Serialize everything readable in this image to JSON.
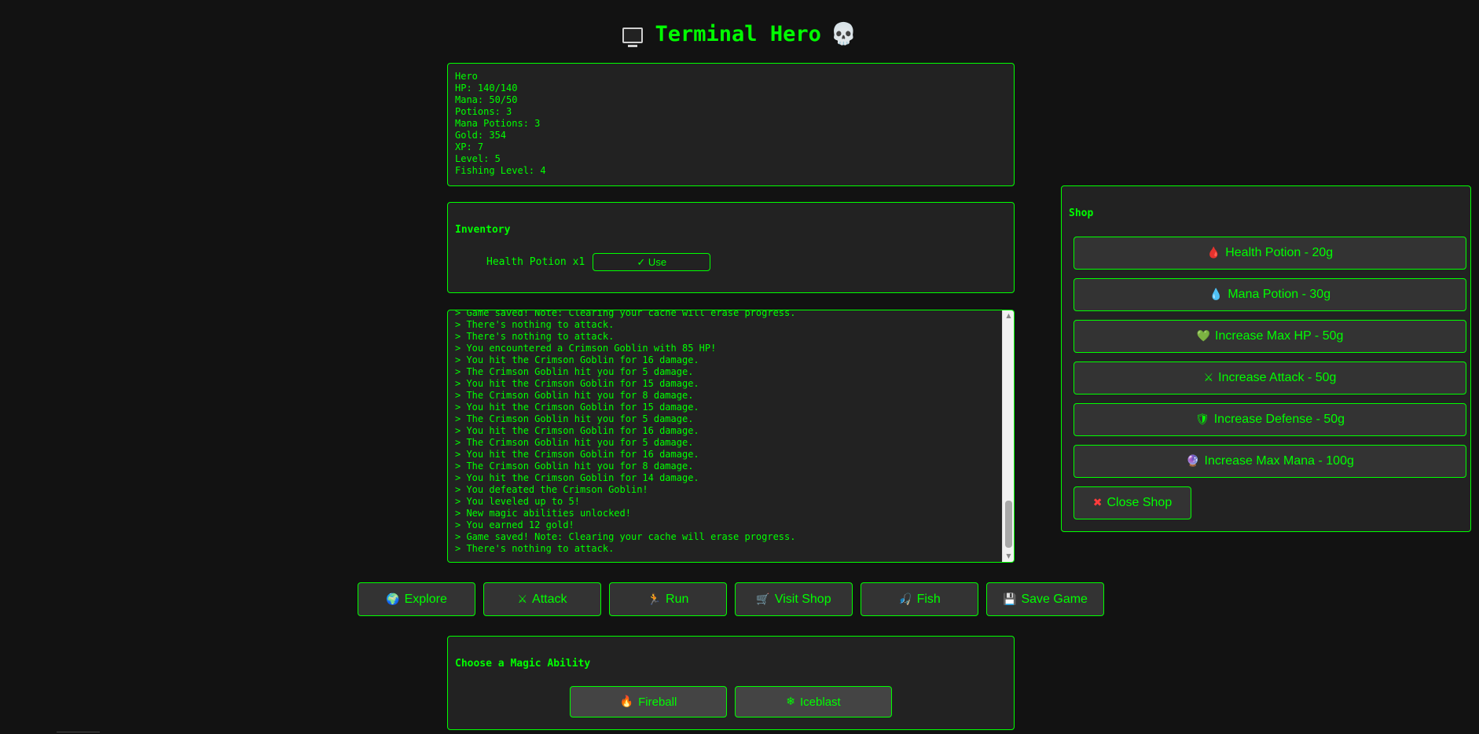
{
  "app": {
    "title": "Terminal Hero",
    "title_icon_left": "monitor-icon",
    "title_icon_right": "skull-icon"
  },
  "stats": {
    "name": "Hero",
    "hp": "HP: 140/140",
    "mana": "Mana: 50/50",
    "potions": "Potions: 3",
    "mana_potions": "Mana Potions: 3",
    "gold": "Gold: 354",
    "xp": "XP: 7",
    "level": "Level: 5",
    "fishing_level": "Fishing Level: 4"
  },
  "inventory": {
    "heading": "Inventory",
    "items": [
      {
        "label": "Health Potion x1",
        "action": "✓ Use"
      }
    ]
  },
  "log": {
    "lines": [
      "> Game saved! Note: Clearing your cache will erase progress.",
      "> There's nothing to attack.",
      "> There's nothing to attack.",
      "> You encountered a Crimson Goblin with 85 HP!",
      "> You hit the Crimson Goblin for 16 damage.",
      "> The Crimson Goblin hit you for 5 damage.",
      "> You hit the Crimson Goblin for 15 damage.",
      "> The Crimson Goblin hit you for 8 damage.",
      "> You hit the Crimson Goblin for 15 damage.",
      "> The Crimson Goblin hit you for 5 damage.",
      "> You hit the Crimson Goblin for 16 damage.",
      "> The Crimson Goblin hit you for 5 damage.",
      "> You hit the Crimson Goblin for 16 damage.",
      "> The Crimson Goblin hit you for 8 damage.",
      "> You hit the Crimson Goblin for 14 damage.",
      "> You defeated the Crimson Goblin!",
      "> You leveled up to 5!",
      "> New magic abilities unlocked!",
      "> You earned 12 gold!",
      "> Game saved! Note: Clearing your cache will erase progress.",
      "> There's nothing to attack."
    ]
  },
  "actions": {
    "explore": {
      "icon": "🌍",
      "label": "Explore"
    },
    "attack": {
      "icon": "⚔",
      "label": "Attack"
    },
    "run": {
      "icon": "🏃",
      "label": "Run"
    },
    "shop": {
      "icon": "🛒",
      "label": "Visit Shop"
    },
    "fish": {
      "icon": "🎣",
      "label": "Fish"
    },
    "save": {
      "icon": "💾",
      "label": "Save Game"
    }
  },
  "magic": {
    "heading": "Choose a Magic Ability",
    "fireball": {
      "icon": "🔥",
      "label": "Fireball"
    },
    "iceblast": {
      "icon": "❄",
      "label": "Iceblast"
    }
  },
  "shop": {
    "heading": "Shop",
    "items": [
      {
        "icon": "🩸",
        "label": "Health Potion - 20g"
      },
      {
        "icon": "💧",
        "label": "Mana Potion - 30g"
      },
      {
        "icon": "💚",
        "label": "Increase Max HP - 50g"
      },
      {
        "icon": "⚔",
        "label": "Increase Attack - 50g"
      },
      {
        "icon": "🛡",
        "label": "Increase Defense - 50g"
      },
      {
        "icon": "🔮",
        "label": "Increase Max Mana - 100g"
      }
    ],
    "close": {
      "icon": "✖",
      "label": "Close Shop"
    }
  },
  "colors": {
    "accent": "#00ff00",
    "background": "#121212",
    "panel": "#222222",
    "button": "#333333"
  }
}
